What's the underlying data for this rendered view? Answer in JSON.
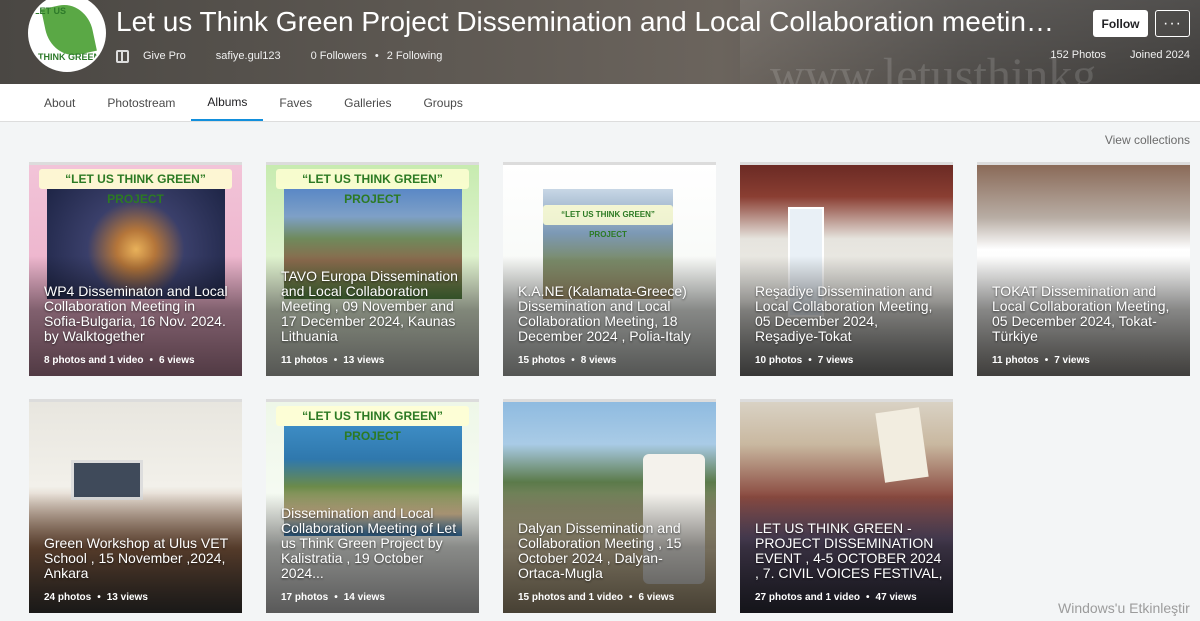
{
  "header": {
    "title": "Let us Think Green Project Dissemination and Local Collaboration meetings an...",
    "avatar_ring_top": "LET US",
    "avatar_ring_bottom": "THINK GREEN",
    "give_pro": "Give Pro",
    "username": "safiye.gul123",
    "followers": "0 Followers",
    "following": "2 Following",
    "photos": "152 Photos",
    "joined": "Joined 2024",
    "watermark": "www.letusthinkg",
    "follow_label": "Follow",
    "more_label": "···"
  },
  "tabs": [
    {
      "label": "About"
    },
    {
      "label": "Photostream"
    },
    {
      "label": "Albums"
    },
    {
      "label": "Faves"
    },
    {
      "label": "Galleries"
    },
    {
      "label": "Groups"
    }
  ],
  "view_collections": "View collections",
  "albums": [
    {
      "title": "WP4 Disseminaton and Local Collaboration Meeting in Sofia-Bulgaria, 16 Nov. 2024. by Walktogether",
      "photos": "8 photos and 1 video",
      "views": "6 views",
      "banner": "“LET US THINK GREEN” PROJECT"
    },
    {
      "title": "TAVO Europa Dissemination and Local Collaboration Meeting , 09 November and 17 December 2024, Kaunas Lithuania",
      "photos": "11 photos",
      "views": "13 views",
      "banner": "“LET US THINK GREEN” PROJECT"
    },
    {
      "title": "K.A.NE (Kalamata-Greece) Dissemination and Local Collaboration Meeting, 18 December 2024 , Polia-Italy",
      "photos": "15 photos",
      "views": "8 views",
      "banner": "“LET US THINK GREEN” PROJECT"
    },
    {
      "title": "Reşadiye Dissemination and Local Collaboration Meeting, 05 December 2024, Reşadiye-Tokat",
      "photos": "10 photos",
      "views": "7 views"
    },
    {
      "title": "TOKAT Dissemination and Local Collaboration Meeting, 05 December 2024, Tokat-Türkiye",
      "photos": "11 photos",
      "views": "7 views"
    },
    {
      "title": "Green Workshop at Ulus VET School , 15 November ,2024, Ankara",
      "photos": "24 photos",
      "views": "13 views"
    },
    {
      "title": "Dissemination and Local Collaboration Meeting of Let us Think Green Project by Kalistratia , 19 October 2024...",
      "photos": "17 photos",
      "views": "14 views",
      "banner": "“LET US THINK GREEN” PROJECT"
    },
    {
      "title": "Dalyan Dissemination and Collaboration Meeting , 15 October 2024 , Dalyan-Ortaca-Mugla",
      "photos": "15 photos and 1 video",
      "views": "6 views"
    },
    {
      "title": "LET US THINK GREEN - PROJECT DISSEMINATION EVENT , 4-5 OCTOBER 2024 , 7. CIVIL VOICES FESTIVAL,",
      "photos": "27 photos and 1 video",
      "views": "47 views"
    }
  ],
  "windows_watermark": "Windows'u Etkinleştir"
}
